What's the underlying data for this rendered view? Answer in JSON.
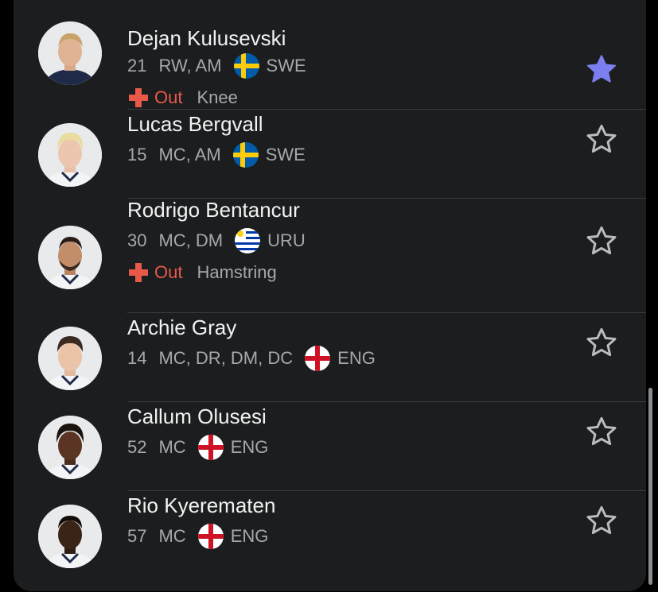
{
  "colors": {
    "card_background": "#1b1d1f",
    "favorite_star": "#7b7ff0",
    "injury_red": "#e8594a",
    "secondary_text": "#a6a8ab"
  },
  "players": [
    {
      "name": "Dejan Kulusevski",
      "number": "21",
      "positions": "RW, AM",
      "flag_icon": "sweden-flag-icon",
      "country": "SWE",
      "injury": {
        "status": "Out",
        "part": "Knee"
      },
      "favorite": true
    },
    {
      "name": "Lucas Bergvall",
      "number": "15",
      "positions": "MC, AM",
      "flag_icon": "sweden-flag-icon",
      "country": "SWE",
      "injury": null,
      "favorite": false
    },
    {
      "name": "Rodrigo Bentancur",
      "number": "30",
      "positions": "MC, DM",
      "flag_icon": "uruguay-flag-icon",
      "country": "URU",
      "injury": {
        "status": "Out",
        "part": "Hamstring"
      },
      "favorite": false
    },
    {
      "name": "Archie Gray",
      "number": "14",
      "positions": "MC, DR, DM, DC",
      "flag_icon": "england-flag-icon",
      "country": "ENG",
      "injury": null,
      "favorite": false
    },
    {
      "name": "Callum Olusesi",
      "number": "52",
      "positions": "MC",
      "flag_icon": "england-flag-icon",
      "country": "ENG",
      "injury": null,
      "favorite": false
    },
    {
      "name": "Rio Kyerematen",
      "number": "57",
      "positions": "MC",
      "flag_icon": "england-flag-icon",
      "country": "ENG",
      "injury": null,
      "favorite": false
    }
  ]
}
